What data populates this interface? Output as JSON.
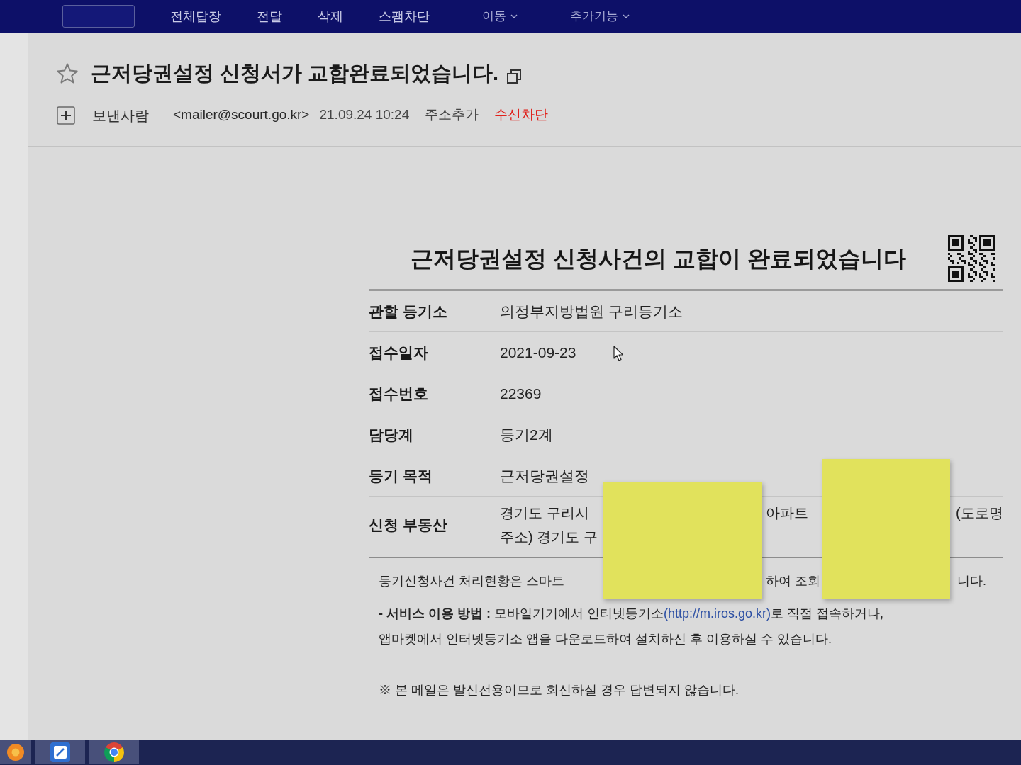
{
  "toolbar": {
    "items": [
      {
        "kind": "box"
      },
      {
        "kind": "text",
        "label": "전체답장"
      },
      {
        "kind": "text",
        "label": "전달"
      },
      {
        "kind": "text",
        "label": "삭제"
      },
      {
        "kind": "text",
        "label": "스팸차단"
      },
      {
        "kind": "menu",
        "label": "이동"
      },
      {
        "kind": "menu",
        "label": "추가기능"
      }
    ]
  },
  "message": {
    "starred": false,
    "subject": "근저당권설정 신청서가 교합완료되었습니다.",
    "sender_label": "보낸사람",
    "sender_address": "<mailer@scourt.go.kr>",
    "date": "21.09.24 10:24",
    "actions": [
      {
        "kind": "normal",
        "label": "주소추가"
      },
      {
        "kind": "danger",
        "label": "수신차단"
      }
    ]
  },
  "body": {
    "title": "근저당권설정 신청사건의 교합이 완료되었습니다",
    "rows": [
      {
        "kind": "text",
        "label": "관할 등기소",
        "value": "의정부지방법원 구리등기소"
      },
      {
        "kind": "text",
        "label": "접수일자",
        "value": "2021-09-23"
      },
      {
        "kind": "text",
        "label": "접수번호",
        "value": "22369"
      },
      {
        "kind": "text",
        "label": "담당계",
        "value": "등기2계"
      },
      {
        "kind": "text",
        "label": "등기 목적",
        "value": "근저당권설정"
      },
      {
        "kind": "partly_covered",
        "label": "신청 부동산",
        "lines": [
          [
            "경기도 구리시",
            "아파트",
            "(도로명"
          ],
          [
            "주소) 경기도 구"
          ]
        ]
      }
    ],
    "notice": {
      "lines": [
        {
          "kind": "partly_covered",
          "parts": [
            "등기신청사건 처리현황은 스마트",
            "하여 조회",
            "니다."
          ]
        },
        {
          "kind": "link_line",
          "before": "**- 서비스 이용 방법 :** 모바일기기에서 인터넷등기소",
          "link": "(http://m.iros.go.kr)",
          "after": "로 직접 접속하거나,"
        },
        {
          "kind": "plain",
          "text": "앱마켓에서 인터넷등기소 앱을 다운로드하여 설치하신 후 이용하실 수 있습니다."
        },
        {
          "kind": "footnote",
          "text": "※ 본 메일은 발신전용이므로 회신하실 경우 답변되지 않습니다."
        }
      ]
    }
  }
}
